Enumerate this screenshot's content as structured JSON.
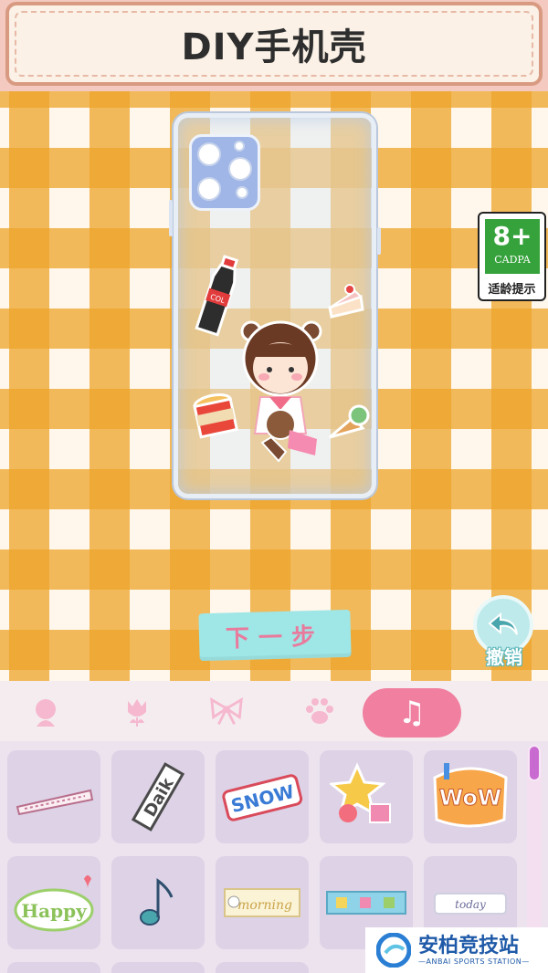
{
  "header": {
    "title": "DIY手机壳"
  },
  "age_badge": {
    "age": "8+",
    "org": "CADPA",
    "label": "适龄提示"
  },
  "actions": {
    "next_label": "下一步",
    "undo_label": "撤销"
  },
  "categories": [
    {
      "icon": "girl-head-icon"
    },
    {
      "icon": "tulip-icon"
    },
    {
      "icon": "bow-icon"
    },
    {
      "icon": "paw-icon"
    },
    {
      "icon": "music-note-icon",
      "active": true,
      "glyph": "♫"
    }
  ],
  "stickers": [
    {
      "label": ""
    },
    {
      "label": ""
    },
    {
      "label": "SNOW"
    },
    {
      "label": ""
    },
    {
      "label": "WoW"
    },
    {
      "label": "Happy"
    },
    {
      "label": "♪"
    },
    {
      "label": "morning"
    },
    {
      "label": ""
    },
    {
      "label": "today"
    }
  ],
  "watermark": {
    "main": "安柏竞技站",
    "sub": "—ANBAI SPORTS STATION—"
  },
  "colors": {
    "accent_pink": "#f07fa0",
    "next_bg": "#9fe6e6",
    "cadpa_green": "#36a23c",
    "gingham": "#eda42a"
  }
}
